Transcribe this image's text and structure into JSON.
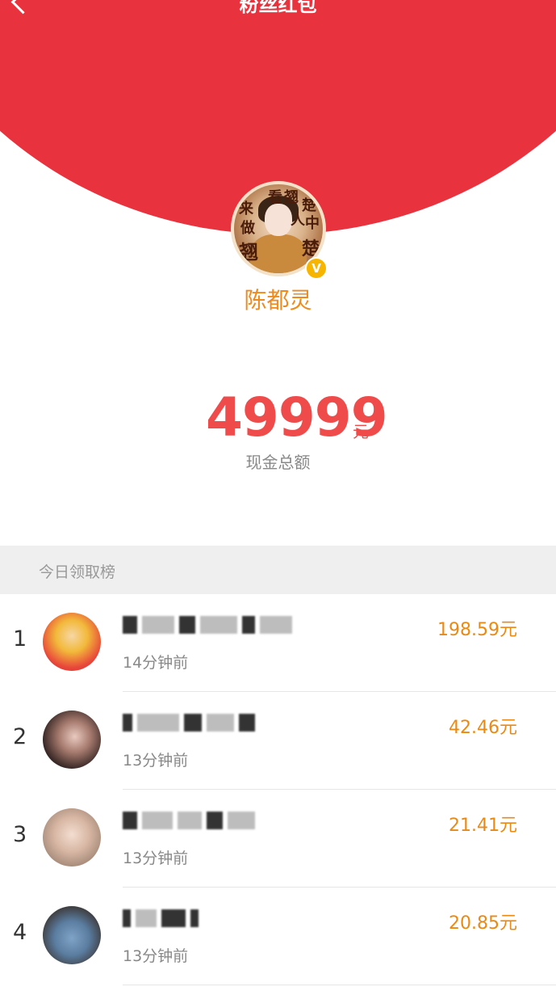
{
  "header": {
    "title": "粉丝红包",
    "red_color": "#e8323e",
    "back_icon": "back-arrow-icon"
  },
  "owner": {
    "avatar_text": [
      "来",
      "看",
      "翘",
      "楚",
      "做",
      "人",
      "中",
      "翘",
      "楚"
    ],
    "name": "陈都灵",
    "verified_badge": "V"
  },
  "summary": {
    "amount": "49999",
    "unit": "元",
    "label": "现金总额"
  },
  "leaderboard": {
    "title": "今日领取榜",
    "rows": [
      {
        "rank": "1",
        "time": "14分钟前",
        "amount": "198.59元"
      },
      {
        "rank": "2",
        "time": "13分钟前",
        "amount": "42.46元"
      },
      {
        "rank": "3",
        "time": "13分钟前",
        "amount": "21.41元"
      },
      {
        "rank": "4",
        "time": "13分钟前",
        "amount": "20.85元"
      }
    ]
  }
}
